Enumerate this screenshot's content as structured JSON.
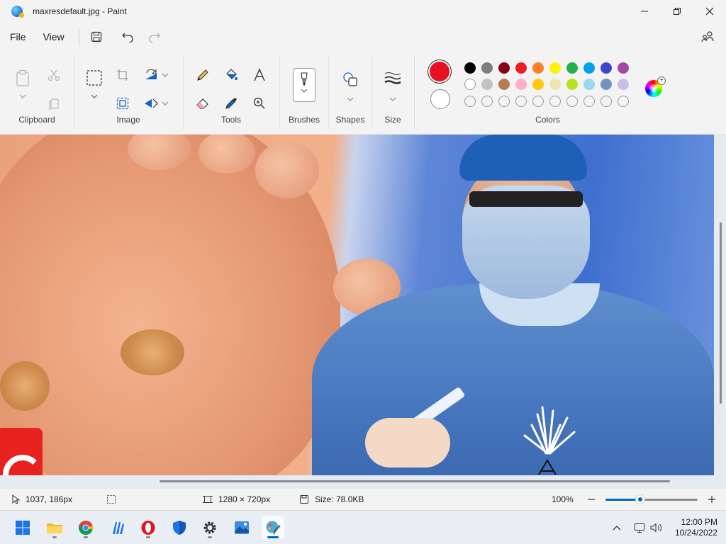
{
  "window": {
    "title": "maxresdefault.jpg - Paint",
    "controls": [
      "minimize",
      "maximize",
      "close"
    ]
  },
  "menu": {
    "file": "File",
    "view": "View"
  },
  "ribbon": {
    "groups": {
      "clipboard": "Clipboard",
      "image": "Image",
      "tools": "Tools",
      "brushes": "Brushes",
      "shapes": "Shapes",
      "size": "Size",
      "colors": "Colors"
    }
  },
  "colors": {
    "primary": "#e81123",
    "secondary": "#ffffff",
    "row1": [
      "#000000",
      "#7f7f7f",
      "#880015",
      "#ed1c24",
      "#ff7f27",
      "#fff200",
      "#22b14c",
      "#00a2e8",
      "#3f48cc",
      "#a349a4"
    ],
    "row2": [
      "#ffffff",
      "#c3c3c3",
      "#b97a57",
      "#ffaec9",
      "#ffc90e",
      "#efe4b0",
      "#b5e61d",
      "#99d9ea",
      "#7092be",
      "#c8bfe7"
    ],
    "row3_empty_count": 10
  },
  "status": {
    "cursor_position": "1037, 186px",
    "canvas_size": "1280 × 720px",
    "file_size": "Size: 78.0KB",
    "zoom": "100%",
    "zoom_fraction": 0.38
  },
  "taskbar": {
    "apps": [
      "start",
      "file-explorer",
      "chrome",
      "app-store",
      "opera",
      "defender",
      "settings",
      "photos",
      "paint"
    ],
    "active_app": "paint",
    "time": "12:00 PM",
    "date": "10/24/2022"
  }
}
